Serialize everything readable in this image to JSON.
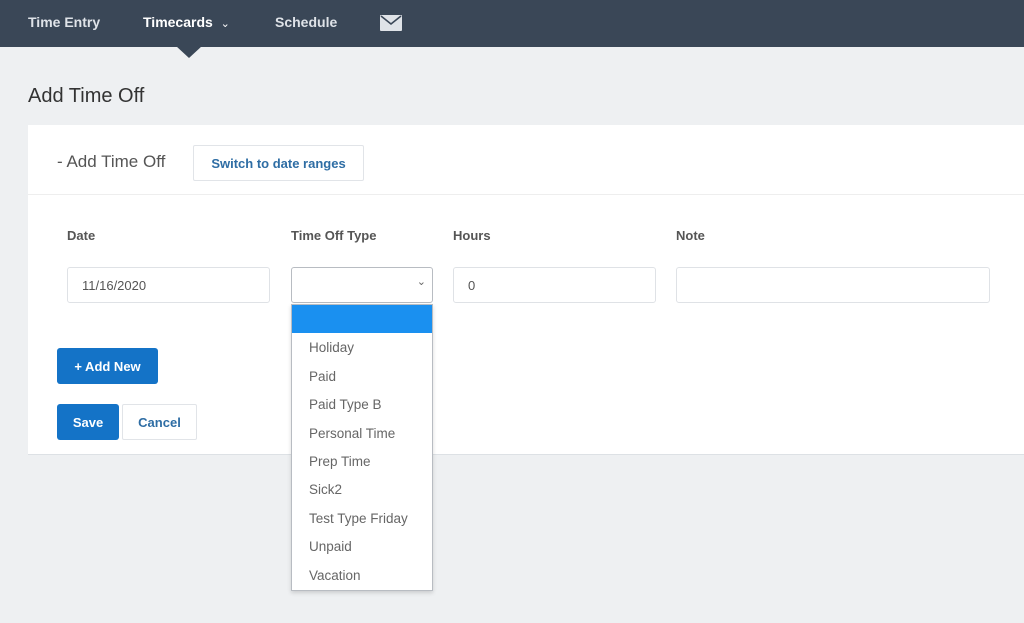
{
  "nav": {
    "items": [
      "Time Entry",
      "Timecards",
      "Schedule"
    ],
    "mail_icon": "envelope-icon",
    "active": "Timecards"
  },
  "page": {
    "title": "Add Time Off"
  },
  "form": {
    "section_title": "- Add Time Off",
    "switch_label": "Switch to date ranges",
    "columns": {
      "date": "Date",
      "type": "Time Off Type",
      "hours": "Hours",
      "note": "Note"
    },
    "row": {
      "date": "11/16/2020",
      "type": "",
      "hours": "0",
      "note": ""
    },
    "add_new": "+ Add New",
    "save": "Save",
    "cancel": "Cancel"
  },
  "dropdown": {
    "options": [
      "",
      "Holiday",
      "Paid",
      "Paid Type B",
      "Personal Time",
      "Prep Time",
      "Sick2",
      "Test Type Friday",
      "Unpaid",
      "Vacation"
    ],
    "highlight_color": "#1a90f0"
  }
}
